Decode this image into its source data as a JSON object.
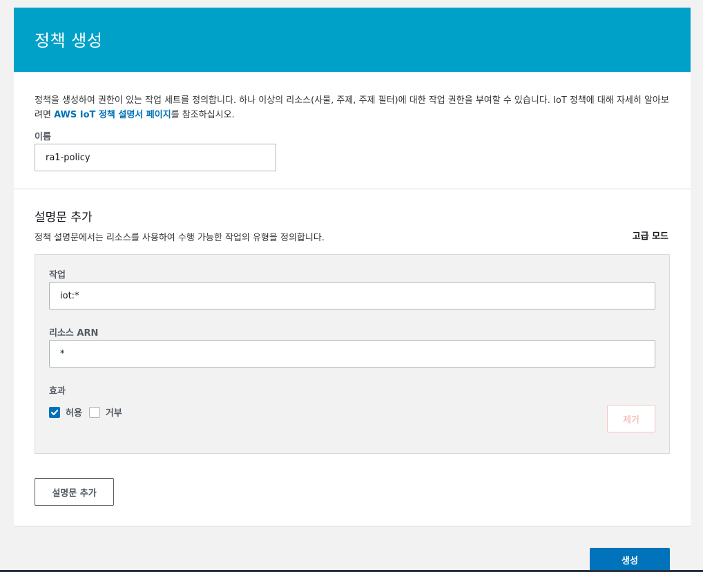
{
  "header": {
    "title": "정책 생성"
  },
  "intro": {
    "text_before_link": "정책을 생성하여 권한이 있는 작업 세트를 정의합니다. 하나 이상의 리소스(사물, 주제, 주제 필터)에 대한 작업 권한을 부여할 수 있습니다. IoT 정책에 대해 자세히 알아보려면 ",
    "link_text": "AWS IoT 정책 설명서 페이지",
    "text_after_link": "를 참조하십시오."
  },
  "name_field": {
    "label": "이름",
    "value": "ra1-policy"
  },
  "statements": {
    "title": "설명문 추가",
    "description": "정책 설명문에서는 리소스를 사용하여 수행 가능한 작업의 유형을 정의합니다.",
    "advanced_mode": "고급 모드",
    "statement": {
      "action_label": "작업",
      "action_value": "iot:*",
      "resource_label": "리소스 ARN",
      "resource_value": "*",
      "effect_label": "효과",
      "allow_label": "허용",
      "allow_checked": true,
      "deny_label": "거부",
      "deny_checked": false,
      "remove_label": "제거"
    },
    "add_statement_label": "설명문 추가"
  },
  "footer": {
    "create_label": "생성"
  },
  "colors": {
    "header_bg": "#00a1c9",
    "link": "#0073bb",
    "primary_button": "#0073bb",
    "remove_border": "#f4c7c0"
  }
}
